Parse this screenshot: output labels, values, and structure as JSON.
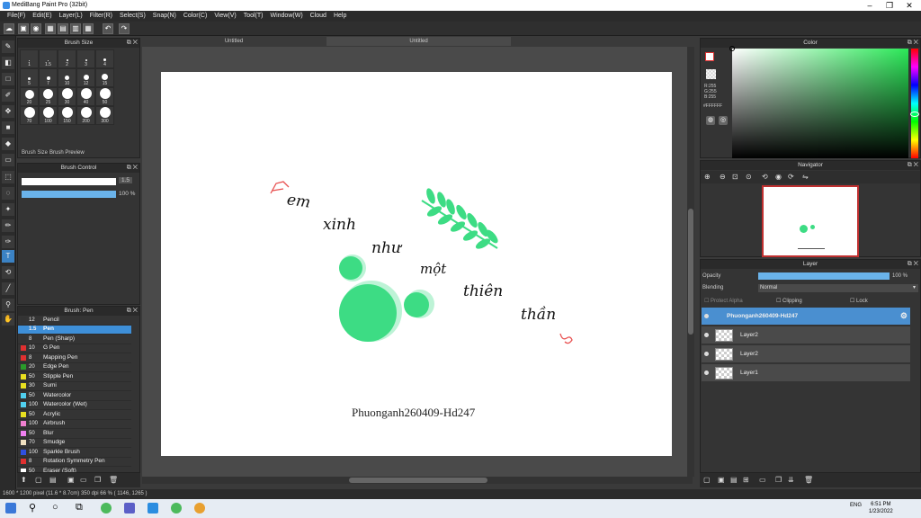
{
  "window": {
    "title": "MediBang Paint Pro (32bit)",
    "min": "–",
    "max": "❐",
    "close": "✕"
  },
  "menu": [
    "File(F)",
    "Edit(E)",
    "Layer(L)",
    "Filter(R)",
    "Select(S)",
    "Snap(N)",
    "Color(C)",
    "View(V)",
    "Tool(T)",
    "Window(W)",
    "Cloud",
    "Help"
  ],
  "tabs": {
    "left": "Untitled",
    "right": "Untitled"
  },
  "brush_size": {
    "title": "Brush Size",
    "rows": [
      [
        "1",
        "1.5",
        "2",
        "3",
        "4"
      ],
      [
        "5",
        "7",
        "10",
        "12",
        "15"
      ],
      [
        "20",
        "25",
        "30",
        "40",
        "50"
      ],
      [
        "70",
        "100",
        "150",
        "200",
        "300"
      ]
    ],
    "tab1": "Brush Size",
    "tab2": "Brush Preview"
  },
  "brush_control": {
    "title": "Brush Control",
    "size": "1.5",
    "opacity": "100 %"
  },
  "brush_list": {
    "title": "Brush: Pen",
    "items": [
      {
        "num": "12",
        "name": "Pencil",
        "color": "#333333"
      },
      {
        "num": "1.5",
        "name": "Pen",
        "color": "#3e8fd8",
        "selected": true
      },
      {
        "num": "8",
        "name": "Pen (Sharp)",
        "color": "#333333"
      },
      {
        "num": "10",
        "name": "G Pen",
        "color": "#e03030"
      },
      {
        "num": "8",
        "name": "Mapping Pen",
        "color": "#e03030"
      },
      {
        "num": "20",
        "name": "Edge Pen",
        "color": "#2a9a2a"
      },
      {
        "num": "50",
        "name": "Stipple Pen",
        "color": "#e8e020"
      },
      {
        "num": "30",
        "name": "Sumi",
        "color": "#e8e020"
      },
      {
        "num": "50",
        "name": "Watercolor",
        "color": "#50d0f0"
      },
      {
        "num": "100",
        "name": "Watercolor (Wet)",
        "color": "#50d0f0"
      },
      {
        "num": "50",
        "name": "Acrylic",
        "color": "#e8e020"
      },
      {
        "num": "100",
        "name": "Airbrush",
        "color": "#f080d0"
      },
      {
        "num": "50",
        "name": "Blur",
        "color": "#f080f0"
      },
      {
        "num": "70",
        "name": "Smudge",
        "color": "#f0e0c0"
      },
      {
        "num": "100",
        "name": "Sparkle Brush",
        "color": "#3050e0"
      },
      {
        "num": "8",
        "name": "Rotation Symmetry Pen",
        "color": "#e03030"
      },
      {
        "num": "50",
        "name": "Eraser (Soft)",
        "color": "#ffffff"
      }
    ]
  },
  "canvas_text": {
    "words": [
      "em",
      "xinh",
      "như",
      "một",
      "thiên",
      "thần"
    ],
    "caption": "Phuonganh260409-Hd247"
  },
  "color": {
    "title": "Color",
    "r": "R:255",
    "g": "G:255",
    "b": "B:255",
    "hex": "#FFFFFF"
  },
  "navigator": {
    "title": "Navigator"
  },
  "layer": {
    "title": "Layer",
    "opacity_label": "Opacity",
    "opacity": "100 %",
    "opacity_value": 1.0,
    "blending_label": "Blending",
    "blending": "Normal",
    "protect": "Protect Alpha",
    "clipping": "Clipping",
    "lock": "Lock",
    "layers": [
      {
        "name": "Phuonganh260409-Hd247",
        "selected": true
      },
      {
        "name": "Layer2"
      },
      {
        "name": "Layer2"
      },
      {
        "name": "Layer1"
      }
    ]
  },
  "status": "1600 * 1200 pixel  (11.6 * 8.7cm)  350 dpi  66 %  ( 1146, 1265 )",
  "taskbar": {
    "time": "6:51 PM",
    "date": "1/23/2022",
    "lang": "ENG"
  },
  "colors": {
    "accent": "#3e8fd8",
    "leaf": "#3ddc84",
    "bg": "#343434"
  }
}
